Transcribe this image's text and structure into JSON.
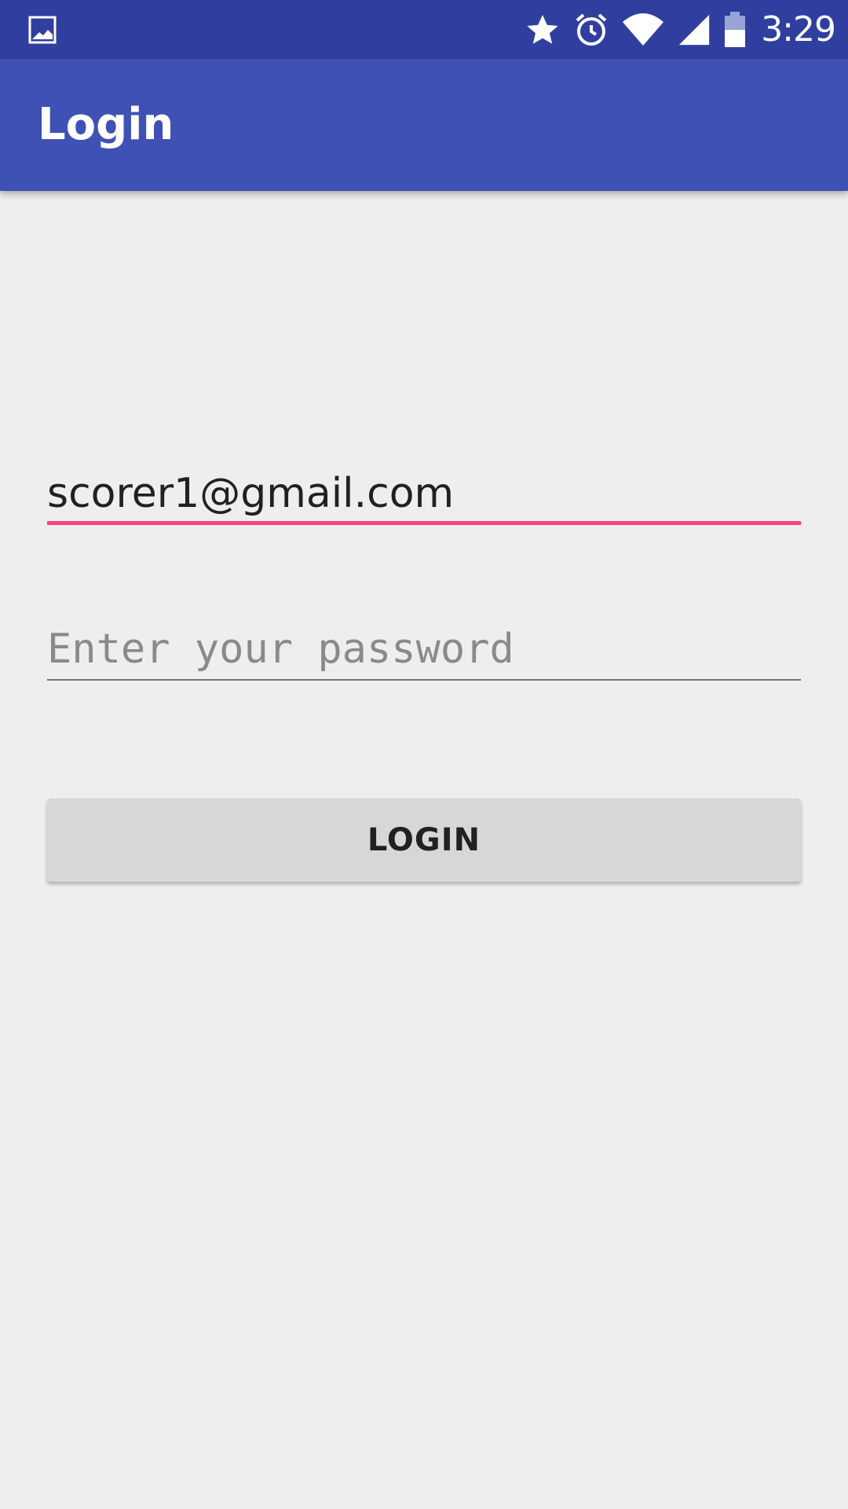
{
  "status_bar": {
    "time": "3:29",
    "icons": [
      "gallery-icon",
      "star-icon",
      "alarm-icon",
      "wifi-icon",
      "signal-icon",
      "battery-icon"
    ],
    "background_color": "#303f9f"
  },
  "app_bar": {
    "title": "Login",
    "background_color": "#3f51b5"
  },
  "login_form": {
    "email_value": "scorer1@gmail.com",
    "password_value": "",
    "password_placeholder": "Enter your password",
    "login_button_label": "LOGIN",
    "focused_underline_color": "#ff4081"
  }
}
